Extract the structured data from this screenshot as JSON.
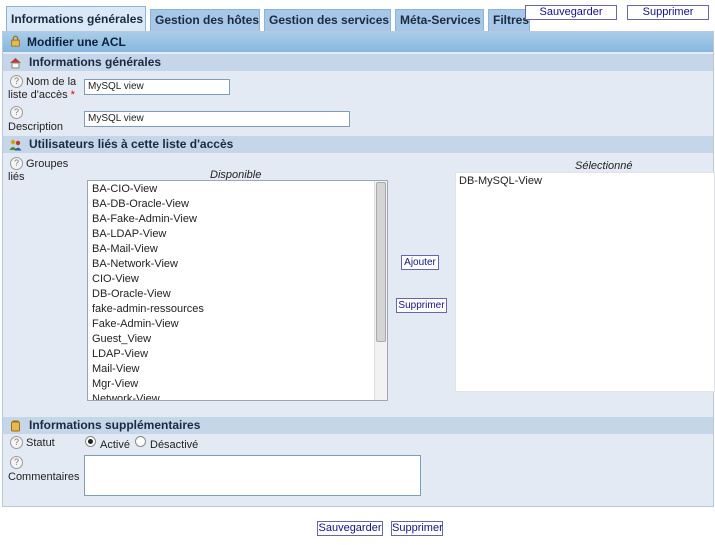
{
  "tabs": [
    {
      "label": "Informations générales",
      "active": true
    },
    {
      "label": "Gestion des hôtes",
      "active": false
    },
    {
      "label": "Gestion des services",
      "active": false
    },
    {
      "label": "Méta-Services",
      "active": false
    },
    {
      "label": "Filtres",
      "active": false
    }
  ],
  "top_actions": {
    "save_label": "Sauvegarder",
    "delete_label": "Supprimer"
  },
  "page_title": "Modifier une ACL",
  "sections": {
    "general": "Informations générales",
    "users": "Utilisateurs liés à cette liste d'accès",
    "extra": "Informations supplémentaires"
  },
  "form": {
    "name_label_line1": "Nom de la",
    "name_label_line2": "liste d'accès",
    "name_value": "MySQL view",
    "description_label": "Description",
    "description_value": "MySQL view",
    "groups_label_line1": "Groupes",
    "groups_label_line2": "liés",
    "status_label": "Statut",
    "status_active": "Activé",
    "status_inactive": "Désactivé",
    "comments_label": "Commentaires",
    "comments_value": ""
  },
  "groups": {
    "available_label": "Disponible",
    "selected_label": "Sélectionné",
    "available": [
      "BA-CIO-View",
      "BA-DB-Oracle-View",
      "BA-Fake-Admin-View",
      "BA-LDAP-View",
      "BA-Mail-View",
      "BA-Network-View",
      "CIO-View",
      "DB-Oracle-View",
      "fake-admin-ressources",
      "Fake-Admin-View",
      "Guest_View",
      "LDAP-View",
      "Mail-View",
      "Mgr-View",
      "Network-View"
    ],
    "selected": [
      "DB-MySQL-View"
    ],
    "add_label": "Ajouter",
    "remove_label": "Supprimer"
  },
  "bottom_actions": {
    "save_label": "Sauvegarder",
    "delete_label": "Supprimer"
  },
  "colors": {
    "tab_active": "#dbe8f6",
    "tab": "#a7c7e8",
    "header": "#86b6de",
    "section": "#c6d6e9",
    "panel": "#e4eaf3"
  }
}
